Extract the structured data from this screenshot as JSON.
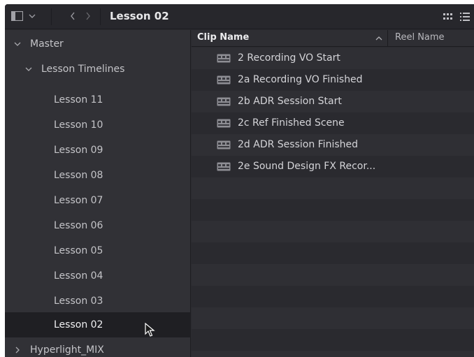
{
  "toolbar": {
    "title": "Lesson 02",
    "icons": [
      "sidebar-toggle-icon",
      "chevron-down-icon",
      "chevron-left-icon",
      "chevron-right-icon",
      "grid-view-icon",
      "list-view-icon"
    ]
  },
  "sidebar": {
    "master": "Master",
    "lesson_timelines": "Lesson Timelines",
    "items": [
      "Lesson 11",
      "Lesson 10",
      "Lesson 09",
      "Lesson 08",
      "Lesson 07",
      "Lesson 06",
      "Lesson 05",
      "Lesson 04",
      "Lesson 03",
      "Lesson 02"
    ],
    "selected": "Lesson 02",
    "hyperlight": "Hyperlight_MIX"
  },
  "list": {
    "col_clip_name": "Clip Name",
    "col_reel_name": "Reel Name",
    "sort": "ascending",
    "clips": [
      "2 Recording VO Start",
      "2a Recording VO Finished",
      "2b ADR Session Start",
      "2c Ref Finished Scene",
      "2d ADR Session Finished",
      "2e Sound Design FX Recor..."
    ]
  },
  "colors": {
    "panel": "#313136",
    "list_bg": "#2a2a2f",
    "selected_row": "#1f1f23",
    "text": "#c8c8cc"
  }
}
